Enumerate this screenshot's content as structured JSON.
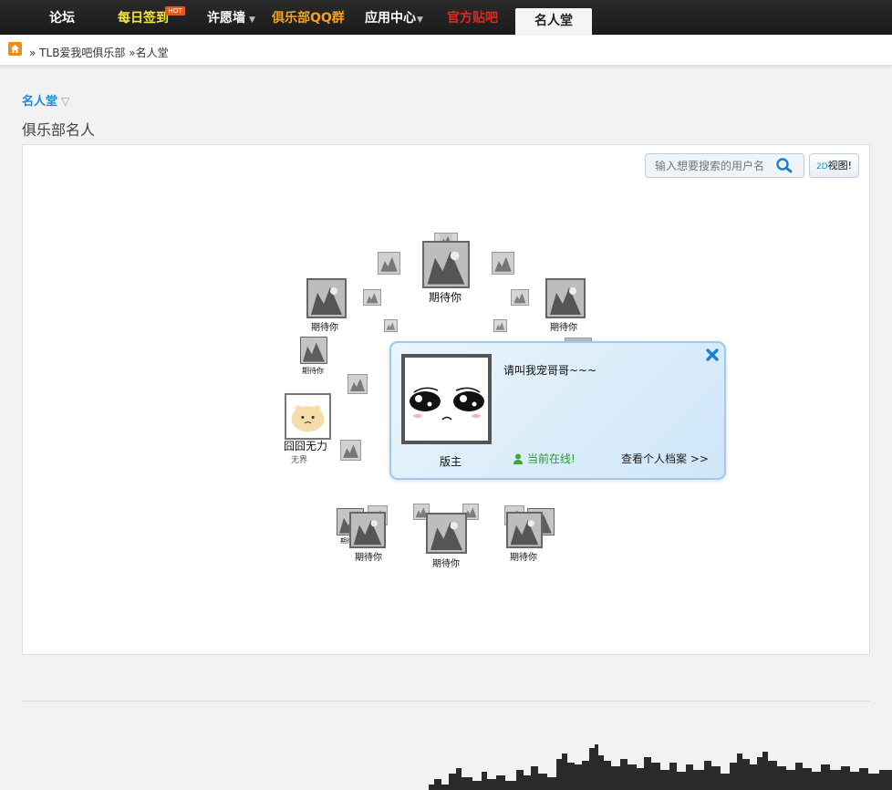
{
  "nav": {
    "items": [
      {
        "label": "论坛",
        "color": "#ffffff"
      },
      {
        "label": "每日签到",
        "color": "#f5e63b",
        "badge": "HOT"
      },
      {
        "label": "许愿墙",
        "color": "#ffffff",
        "dropdown": true
      },
      {
        "label": "俱乐部QQ群",
        "color": "#f4a01f"
      },
      {
        "label": "应用中心",
        "color": "#ffffff",
        "dropdown": true
      },
      {
        "label": "官方贴吧",
        "color": "#e3281f"
      },
      {
        "label": "名人堂",
        "color": "#222222",
        "active": true
      }
    ]
  },
  "breadcrumb": {
    "home_icon": "home-icon",
    "sep": "»",
    "items": [
      "TLB爱我吧俱乐部",
      "名人堂"
    ]
  },
  "section_link": "名人堂",
  "section_caret": "▽",
  "page_title": "俱乐部名人",
  "search": {
    "placeholder": "输入想要搜索的用户名"
  },
  "view_toggle": {
    "prefix": "2D",
    "label": "视图!"
  },
  "members": {
    "top": "期待你",
    "upper_left": "期待你",
    "upper_right": "期待你",
    "left_small": "期待你",
    "left_named": "囧囧无力",
    "left_named_sub": "无界",
    "bottom_left_small": "期待你",
    "bottom_left": "期待你",
    "bottom_center": "期待你",
    "bottom_right": "期待你"
  },
  "popup": {
    "bio": "请叫我宠哥哥~~~",
    "role": "版主",
    "online": "当前在线!",
    "profile_link": "查看个人档案 >>"
  },
  "colors": {
    "accent": "#1d8bd1",
    "online": "#2a9a2a",
    "hot_badge": "#e15a1f"
  }
}
